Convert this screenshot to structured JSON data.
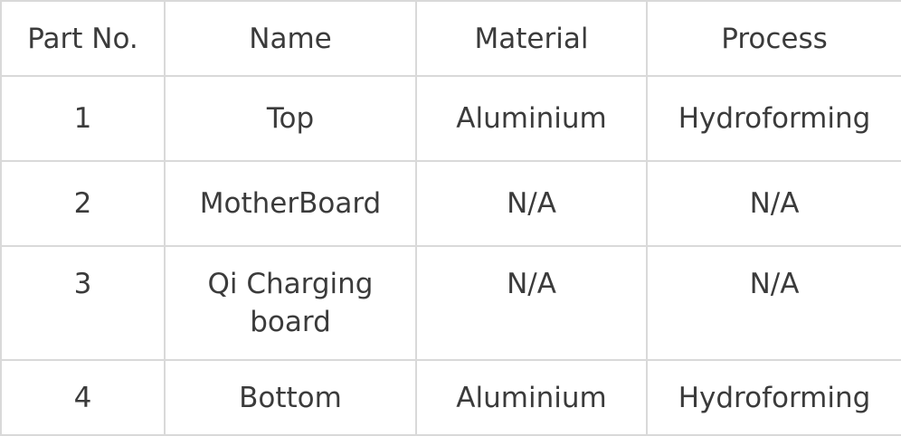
{
  "table": {
    "headers": [
      "Part No.",
      "Name",
      "Material",
      "Process"
    ],
    "rows": [
      [
        "1",
        "Top",
        "Aluminium",
        "Hydroforming"
      ],
      [
        "2",
        "MotherBoard",
        "N/A",
        "N/A"
      ],
      [
        "3",
        "Qi Charging board",
        "N/A",
        "N/A"
      ],
      [
        "4",
        "Bottom",
        "Aluminium",
        "Hydroforming"
      ]
    ]
  }
}
